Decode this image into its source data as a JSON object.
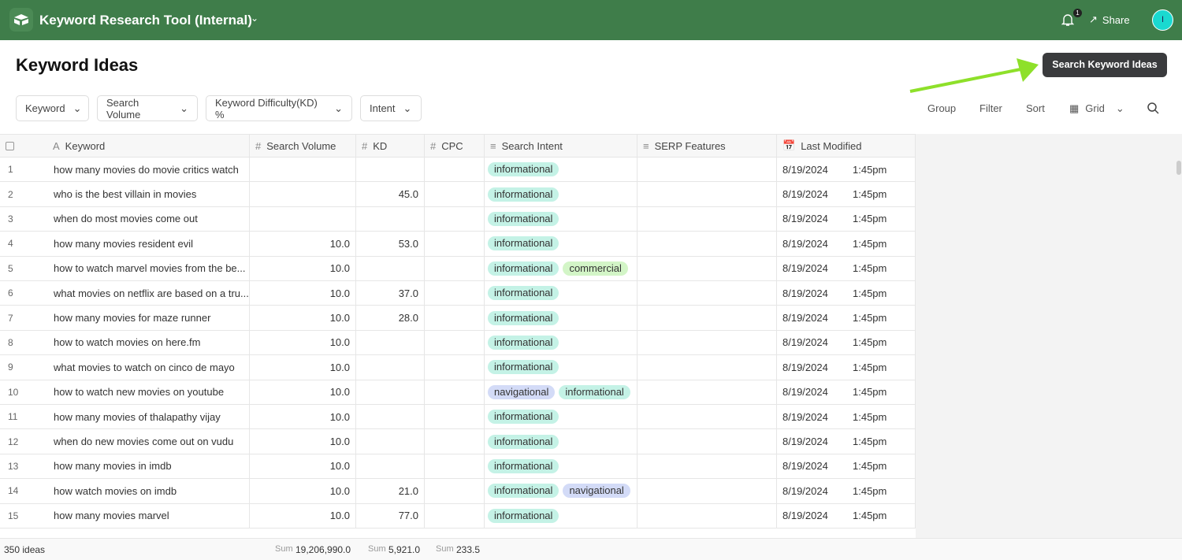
{
  "app": {
    "title": "Keyword Research Tool (Internal)",
    "notifications": "1",
    "share": "Share",
    "avatar": "I"
  },
  "page": {
    "title": "Keyword Ideas",
    "primary_button": "Search Keyword Ideas"
  },
  "filters": [
    "Keyword",
    "Search Volume",
    "Keyword Difficulty(KD) %",
    "Intent"
  ],
  "toolbar": {
    "group": "Group",
    "filter": "Filter",
    "sort": "Sort",
    "view": "Grid"
  },
  "columns": [
    "Keyword",
    "Search Volume",
    "KD",
    "CPC",
    "Search Intent",
    "SERP Features",
    "Last Modified"
  ],
  "intent_colors": {
    "informational": "#c4f2e6",
    "commercial": "#d3f5c7",
    "navigational": "#d3dbf7"
  },
  "rows": [
    {
      "n": "1",
      "keyword": "how many movies do movie critics watch",
      "sv": "",
      "kd": "",
      "cpc": "",
      "intent": [
        "informational"
      ],
      "date": "8/19/2024",
      "time": "1:45pm"
    },
    {
      "n": "2",
      "keyword": "who is the best villain in movies",
      "sv": "",
      "kd": "45.0",
      "cpc": "",
      "intent": [
        "informational"
      ],
      "date": "8/19/2024",
      "time": "1:45pm"
    },
    {
      "n": "3",
      "keyword": "when do most movies come out",
      "sv": "",
      "kd": "",
      "cpc": "",
      "intent": [
        "informational"
      ],
      "date": "8/19/2024",
      "time": "1:45pm"
    },
    {
      "n": "4",
      "keyword": "how many movies resident evil",
      "sv": "10.0",
      "kd": "53.0",
      "cpc": "",
      "intent": [
        "informational"
      ],
      "date": "8/19/2024",
      "time": "1:45pm"
    },
    {
      "n": "5",
      "keyword": "how to watch marvel movies from the be...",
      "sv": "10.0",
      "kd": "",
      "cpc": "",
      "intent": [
        "informational",
        "commercial"
      ],
      "date": "8/19/2024",
      "time": "1:45pm"
    },
    {
      "n": "6",
      "keyword": "what movies on netflix are based on a tru...",
      "sv": "10.0",
      "kd": "37.0",
      "cpc": "",
      "intent": [
        "informational"
      ],
      "date": "8/19/2024",
      "time": "1:45pm"
    },
    {
      "n": "7",
      "keyword": "how many movies for maze runner",
      "sv": "10.0",
      "kd": "28.0",
      "cpc": "",
      "intent": [
        "informational"
      ],
      "date": "8/19/2024",
      "time": "1:45pm"
    },
    {
      "n": "8",
      "keyword": "how to watch movies on here.fm",
      "sv": "10.0",
      "kd": "",
      "cpc": "",
      "intent": [
        "informational"
      ],
      "date": "8/19/2024",
      "time": "1:45pm"
    },
    {
      "n": "9",
      "keyword": "what movies to watch on cinco de mayo",
      "sv": "10.0",
      "kd": "",
      "cpc": "",
      "intent": [
        "informational"
      ],
      "date": "8/19/2024",
      "time": "1:45pm"
    },
    {
      "n": "10",
      "keyword": "how to watch new movies on youtube",
      "sv": "10.0",
      "kd": "",
      "cpc": "",
      "intent": [
        "navigational",
        "informational"
      ],
      "date": "8/19/2024",
      "time": "1:45pm"
    },
    {
      "n": "11",
      "keyword": "how many movies of thalapathy vijay",
      "sv": "10.0",
      "kd": "",
      "cpc": "",
      "intent": [
        "informational"
      ],
      "date": "8/19/2024",
      "time": "1:45pm"
    },
    {
      "n": "12",
      "keyword": "when do new movies come out on vudu",
      "sv": "10.0",
      "kd": "",
      "cpc": "",
      "intent": [
        "informational"
      ],
      "date": "8/19/2024",
      "time": "1:45pm"
    },
    {
      "n": "13",
      "keyword": "how many movies in imdb",
      "sv": "10.0",
      "kd": "",
      "cpc": "",
      "intent": [
        "informational"
      ],
      "date": "8/19/2024",
      "time": "1:45pm"
    },
    {
      "n": "14",
      "keyword": "how watch movies on imdb",
      "sv": "10.0",
      "kd": "21.0",
      "cpc": "",
      "intent": [
        "informational",
        "navigational"
      ],
      "date": "8/19/2024",
      "time": "1:45pm"
    },
    {
      "n": "15",
      "keyword": "how many movies marvel",
      "sv": "10.0",
      "kd": "77.0",
      "cpc": "",
      "intent": [
        "informational"
      ],
      "date": "8/19/2024",
      "time": "1:45pm"
    }
  ],
  "footer": {
    "count": "350 ideas",
    "sum_label": "Sum",
    "sum_sv": "19,206,990.0",
    "sum_kd": "5,921.0",
    "sum_cpc": "233.5"
  }
}
